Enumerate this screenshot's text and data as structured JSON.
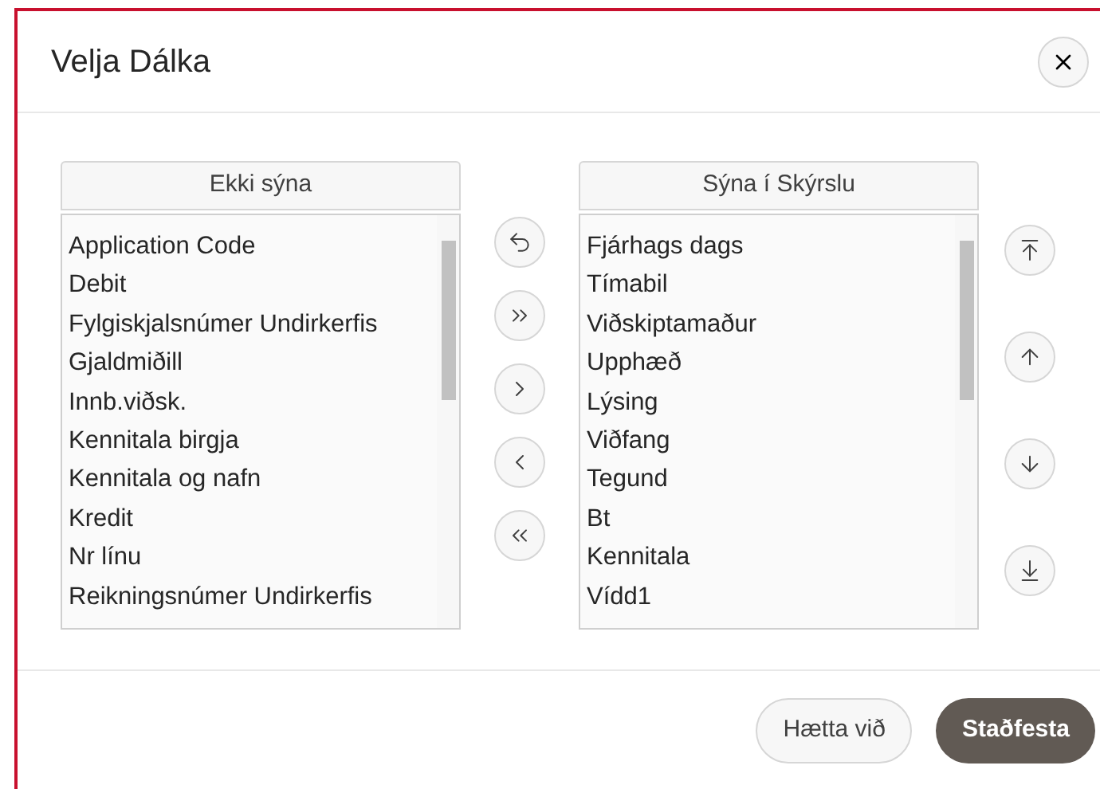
{
  "dialog": {
    "title": "Velja Dálka"
  },
  "available": {
    "header": "Ekki sýna",
    "items": [
      "Application Code",
      "Debit",
      "Fylgiskjalsnúmer Undirkerfis",
      "Gjaldmiðill",
      "Innb.viðsk.",
      "Kennitala birgja",
      "Kennitala og nafn",
      "Kredit",
      "Nr línu",
      "Reikningsnúmer Undirkerfis"
    ]
  },
  "transfer_buttons": [
    {
      "kind": "reset"
    },
    {
      "kind": "move-all-right"
    },
    {
      "kind": "move-right"
    },
    {
      "kind": "move-left"
    },
    {
      "kind": "move-all-left"
    }
  ],
  "shown": {
    "header": "Sýna í Skýrslu",
    "items": [
      "Fjárhags dags",
      "Tímabil",
      "Viðskiptamaður",
      "Upphæð",
      "Lýsing",
      "Viðfang",
      "Tegund",
      "Bt",
      "Kennitala",
      "Vídd1"
    ]
  },
  "order_buttons": [
    {
      "kind": "top"
    },
    {
      "kind": "up"
    },
    {
      "kind": "down"
    },
    {
      "kind": "bottom"
    }
  ],
  "footer": {
    "cancel": "Hætta við",
    "confirm": "Staðfesta"
  }
}
